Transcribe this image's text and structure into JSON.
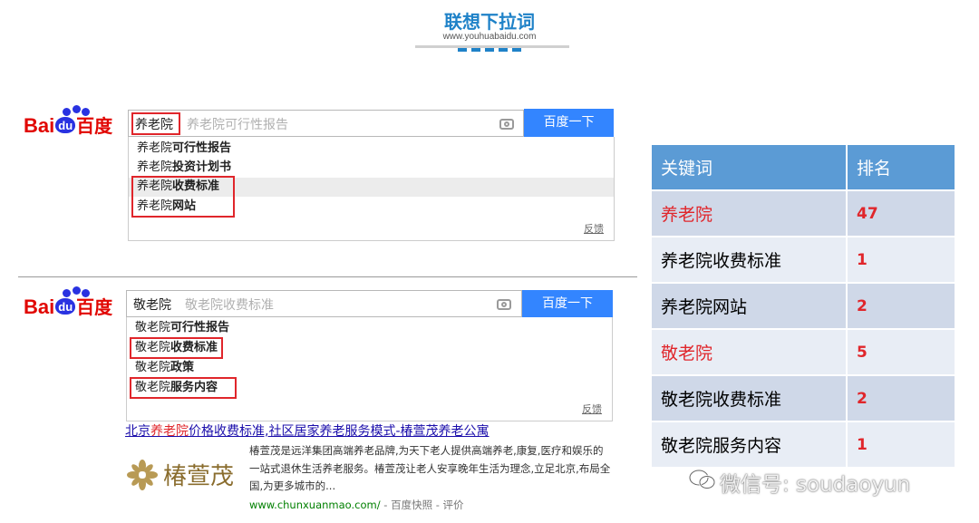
{
  "header": {
    "title": "联想下拉词",
    "subtitle": "www.youhuabaidu.com"
  },
  "logo": {
    "bai": "Bai",
    "du": "du",
    "cn": "百度"
  },
  "search1": {
    "query": "养老院",
    "placeholder": "养老院可行性报告",
    "button": "百度一下",
    "suggestions": [
      {
        "prefix": "养老院",
        "bold": "可行性报告"
      },
      {
        "prefix": "养老院",
        "bold": "投资计划书"
      },
      {
        "prefix": "养老院",
        "bold": "收费标准"
      },
      {
        "prefix": "养老院",
        "bold": "网站"
      }
    ],
    "feedback": "反馈"
  },
  "search2": {
    "query": "敬老院",
    "placeholder": "敬老院收费标准",
    "button": "百度一下",
    "suggestions": [
      {
        "prefix": "敬老院",
        "bold": "可行性报告"
      },
      {
        "prefix": "敬老院",
        "bold": "收费标准"
      },
      {
        "prefix": "敬老院",
        "bold": "政策"
      },
      {
        "prefix": "敬老院",
        "bold": "服务内容"
      }
    ],
    "feedback": "反馈"
  },
  "result": {
    "title_parts": [
      "北京",
      "养老院",
      "价格收费标准,社区居家养老服务模式-椿萱茂养老公寓"
    ],
    "logo_text": "椿萱茂",
    "desc": "椿萱茂是远洋集团高端养老品牌,为天下老人提供高端养老,康复,医疗和娱乐的一站式退休生活养老服务。椿萱茂让老人安享晚年生活为理念,立足北京,布局全国,为更多城市的...",
    "url": "www.chunxuanmao.com/",
    "url_extra": " - 百度快照 - 评价"
  },
  "table": {
    "headers": [
      "关键词",
      "排名"
    ],
    "rows": [
      {
        "keyword": "养老院",
        "rank": "47",
        "red": true
      },
      {
        "keyword": "养老院收费标准",
        "rank": "1",
        "red": false
      },
      {
        "keyword": "养老院网站",
        "rank": "2",
        "red": false
      },
      {
        "keyword": "敬老院",
        "rank": "5",
        "red": true
      },
      {
        "keyword": "敬老院收费标准",
        "rank": "2",
        "red": false
      },
      {
        "keyword": "敬老院服务内容",
        "rank": "1",
        "red": false
      }
    ]
  },
  "watermark": {
    "text": "微信号: soudaoyun",
    "icon": "wechat-icon"
  },
  "colors": {
    "accent": "#1f82c8",
    "button": "#3385ff",
    "highlight": "#e0262b",
    "table_header": "#5b9bd5"
  }
}
